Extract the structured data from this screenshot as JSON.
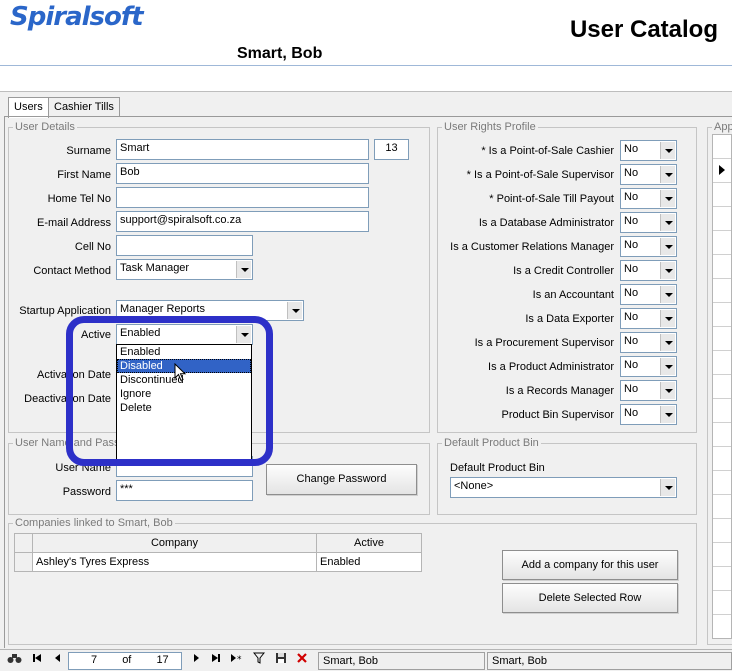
{
  "header": {
    "logo_text": "Spiralsoft",
    "page_title": "User Catalog",
    "user_name": "Smart, Bob"
  },
  "tabs": [
    {
      "label": "Users",
      "active": true
    },
    {
      "label": "Cashier Tills",
      "active": false
    }
  ],
  "user_details": {
    "legend": "User Details",
    "surname_label": "Surname",
    "surname": "Smart",
    "user_id": "13",
    "first_name_label": "First Name",
    "first_name": "Bob",
    "home_tel_label": "Home Tel No",
    "home_tel": "",
    "email_label": "E-mail Address",
    "email": "support@spiralsoft.co.za",
    "cell_label": "Cell No",
    "cell": "",
    "contact_method_label": "Contact Method",
    "contact_method": "Task Manager",
    "startup_app_label": "Startup Application",
    "startup_app": "Manager Reports",
    "active_label": "Active",
    "active_value": "Enabled",
    "activation_label": "Activation Date",
    "deactivation_label": "Deactivation Date"
  },
  "active_dropdown": {
    "options": [
      "Enabled",
      "Disabled",
      "Discontinued",
      "Ignore",
      "Delete"
    ],
    "selected_index": 1
  },
  "user_name_password": {
    "legend": "User Name and Password",
    "username_label": "User Name",
    "password_label": "Password",
    "password_value": "***",
    "change_password_button": "Change Password"
  },
  "user_rights": {
    "legend": "User Rights Profile",
    "rights": [
      {
        "label": "* Is a Point-of-Sale Cashier",
        "value": "No"
      },
      {
        "label": "* Is a Point-of-Sale Supervisor",
        "value": "No"
      },
      {
        "label": "* Point-of-Sale Till Payout",
        "value": "No"
      },
      {
        "label": "Is a Database Administrator",
        "value": "No"
      },
      {
        "label": "Is a Customer Relations Manager",
        "value": "No"
      },
      {
        "label": "Is a Credit Controller",
        "value": "No"
      },
      {
        "label": "Is an Accountant",
        "value": "No"
      },
      {
        "label": "Is a Data Exporter",
        "value": "No"
      },
      {
        "label": "Is a Procurement Supervisor",
        "value": "No"
      },
      {
        "label": "Is a Product Administrator",
        "value": "No"
      },
      {
        "label": "Is a Records Manager",
        "value": "No"
      },
      {
        "label": "Product Bin Supervisor",
        "value": "No"
      }
    ]
  },
  "product_bin": {
    "legend": "Default Product Bin",
    "label": "Default Product Bin",
    "value": "<None>"
  },
  "right_panel": {
    "legend": "App"
  },
  "companies": {
    "legend": "Companies linked to Smart, Bob",
    "columns": [
      "Company",
      "Active"
    ],
    "rows": [
      {
        "company": "Ashley's Tyres Express",
        "active": "Enabled"
      }
    ],
    "add_button": "Add a company for this user",
    "delete_button": "Delete Selected Row"
  },
  "statusbar": {
    "record": "7",
    "of_label": "of",
    "total": "17",
    "status_left": "Smart, Bob",
    "status_right": "Smart, Bob"
  }
}
